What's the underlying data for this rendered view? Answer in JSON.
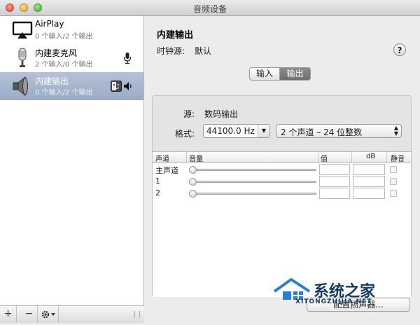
{
  "window": {
    "title": "音频设备"
  },
  "devices": [
    {
      "name": "AirPlay",
      "sub": "0 个输入/2 个输出",
      "icon": "airplay-icon",
      "right_icons": []
    },
    {
      "name": "内建麦克风",
      "sub": "2 个输入/0 个输出",
      "icon": "microphone-icon",
      "right_icons": [
        "microphone-small-icon"
      ]
    },
    {
      "name": "内建输出",
      "sub": "0 个输入/2 个输出",
      "icon": "speaker-icon",
      "right_icons": [
        "finder-icon",
        "volume-icon"
      ],
      "selected": true
    }
  ],
  "bottombar": {
    "add": "+",
    "remove": "−",
    "gear": "gear-icon"
  },
  "main": {
    "title": "内建输出",
    "clock_label": "时钟源:",
    "clock_value": "默认",
    "help": "?",
    "tabs": [
      {
        "label": "输入",
        "selected": false
      },
      {
        "label": "输出",
        "selected": true
      }
    ],
    "source_label": "源:",
    "source_value": "数码输出",
    "format_label": "格式:",
    "format_value": "44100.0 Hz",
    "channel_format": "2 个声道 – 24 位整数",
    "table": {
      "headers": {
        "channel": "声道",
        "volume": "音量",
        "value": "值",
        "db": "dB",
        "mute": "静音"
      },
      "rows": [
        {
          "label": "主声道",
          "level": 0,
          "value": "",
          "db": "",
          "mute": false
        },
        {
          "label": "1",
          "level": 0,
          "value": "",
          "db": "",
          "mute": false
        },
        {
          "label": "2",
          "level": 0,
          "value": "",
          "db": "",
          "mute": false
        }
      ]
    },
    "config_button": "配置扬声器..."
  },
  "watermark": {
    "title": "系统之家",
    "url": "XITONGZHIJIA.NET"
  }
}
